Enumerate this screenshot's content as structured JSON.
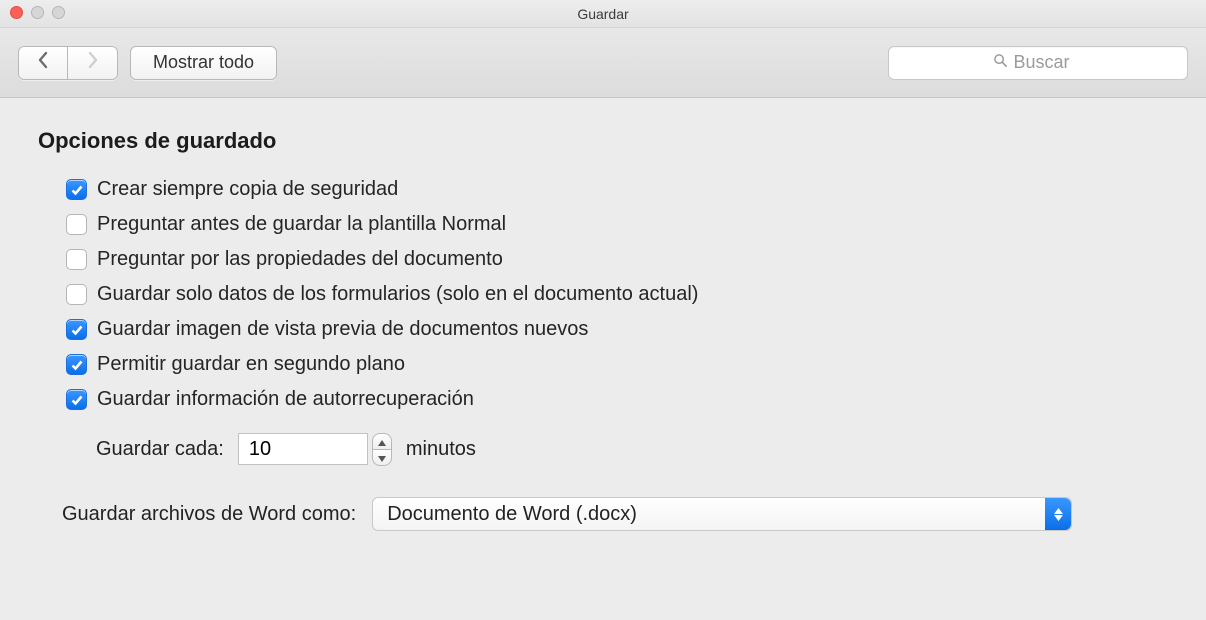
{
  "window": {
    "title": "Guardar"
  },
  "toolbar": {
    "show_all_label": "Mostrar todo",
    "search_placeholder": "Buscar"
  },
  "section": {
    "title": "Opciones de guardado",
    "options": [
      {
        "label": "Crear siempre copia de seguridad",
        "checked": true
      },
      {
        "label": "Preguntar antes de guardar la plantilla Normal",
        "checked": false
      },
      {
        "label": "Preguntar por las propiedades del documento",
        "checked": false
      },
      {
        "label": "Guardar solo datos de los formularios (solo en el documento actual)",
        "checked": false
      },
      {
        "label": "Guardar imagen de vista previa de documentos nuevos",
        "checked": true
      },
      {
        "label": "Permitir guardar en segundo plano",
        "checked": true
      },
      {
        "label": "Guardar información de autorrecuperación",
        "checked": true
      }
    ],
    "save_every": {
      "prefix_label": "Guardar cada:",
      "value": "10",
      "suffix_label": "minutos"
    },
    "save_files_as": {
      "label": "Guardar archivos de Word como:",
      "selected": "Documento de Word (.docx)"
    }
  }
}
